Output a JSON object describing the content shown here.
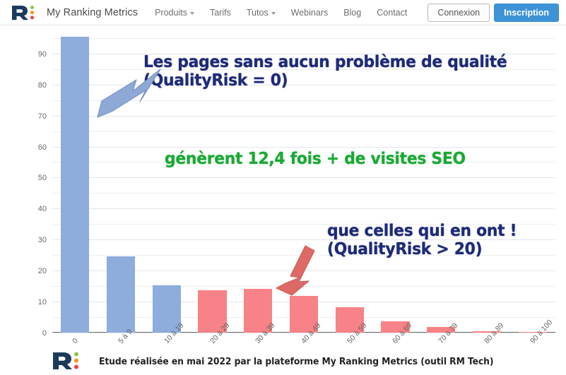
{
  "navbar": {
    "logo": {
      "icon": "r-logo-icon",
      "letter_color": "#1b3a5c",
      "dots": [
        "#8cc63f",
        "#f7941e",
        "#ef3e42"
      ]
    },
    "brand_name": "My Ranking Metrics",
    "links": [
      {
        "label": "Produits",
        "has_caret": true
      },
      {
        "label": "Tarifs",
        "has_caret": false
      },
      {
        "label": "Tutos",
        "has_caret": true
      },
      {
        "label": "Webinars",
        "has_caret": false
      },
      {
        "label": "Blog",
        "has_caret": false
      },
      {
        "label": "Contact",
        "has_caret": false
      }
    ],
    "login_label": "Connexion",
    "signup_label": "Inscription",
    "signup_color": "#3e93d6"
  },
  "annotations": {
    "top": "Les pages sans aucun problème de qualité\n(QualityRisk = 0)",
    "middle": "génèrent 12,4  fois + de visites SEO",
    "bottom": "que celles qui en ont !\n(QualityRisk > 20)",
    "navy_color": "#1e2a78",
    "green_color": "#1aa934",
    "blue_arrow_color": "#8fa9d6",
    "red_arrow_color": "#de6a68"
  },
  "footer": {
    "text": "Etude réalisée en mai 2022 par la plateforme My Ranking Metrics (outil RM Tech)"
  },
  "chart_data": {
    "type": "bar",
    "title": "",
    "xlabel": "",
    "ylabel": "",
    "categories": [
      "0",
      "5 à 9",
      "10 à 19",
      "20 à 29",
      "30 à 39",
      "40 à 49",
      "50 à 59",
      "60 à 69",
      "70 à 79",
      "80 à 89",
      "90 à 100"
    ],
    "values": [
      95.5,
      24.5,
      15.2,
      13.7,
      14.1,
      11.9,
      8.2,
      3.7,
      1.8,
      0.4,
      0.1
    ],
    "bar_colors": [
      "#8eacdc",
      "#8eacdc",
      "#8eacdc",
      "#f78287",
      "#f78287",
      "#f78287",
      "#f78287",
      "#f78287",
      "#f78287",
      "#f78287",
      "#f78287"
    ],
    "ylim": [
      0,
      97
    ],
    "yticks": [
      0,
      10,
      20,
      30,
      40,
      50,
      60,
      70,
      80,
      90
    ],
    "ytick_labels": [
      "0",
      "10",
      "20",
      "30",
      "40",
      "50",
      "60",
      "70",
      "80",
      "90"
    ],
    "minor_gridlines": [
      5,
      15,
      25,
      35,
      45,
      55,
      65,
      75,
      85,
      95
    ],
    "grid": true,
    "legend": "none"
  }
}
